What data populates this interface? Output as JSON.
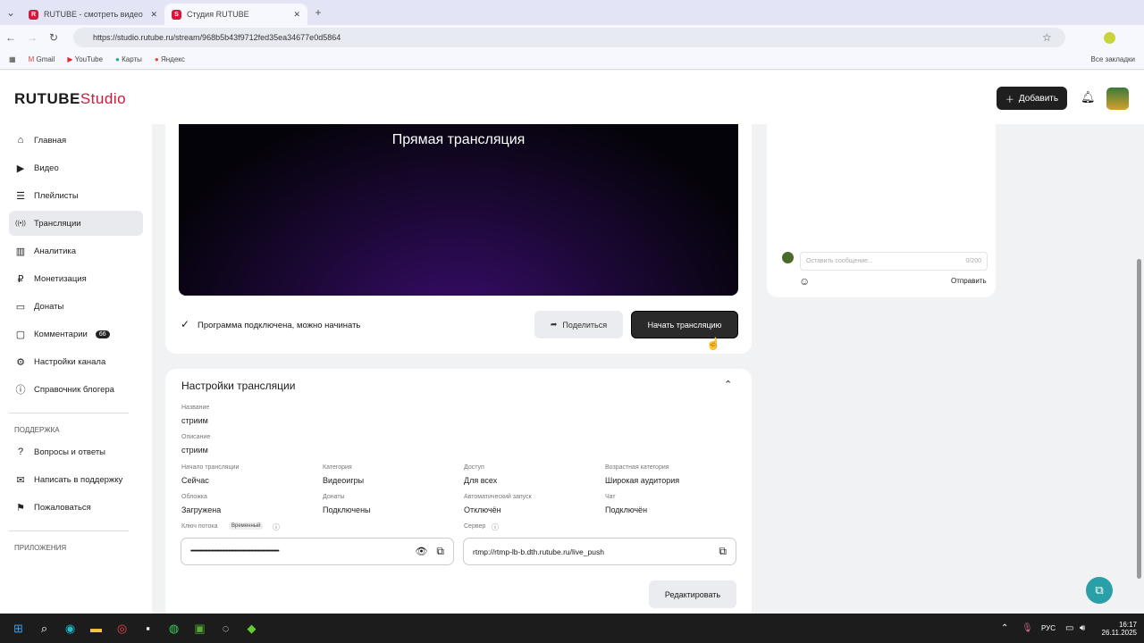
{
  "browser": {
    "tabs": [
      {
        "title": "RUTUBE - смотреть видео онлайн",
        "icon": "R"
      },
      {
        "title": "Студия RUTUBE",
        "icon": "S"
      }
    ],
    "url": "https://studio.rutube.ru/stream/968b5b43f9712fed35ea34677e0d5864",
    "bookmarks": [
      "Gmail",
      "YouTube",
      "Карты",
      "Яндекс"
    ],
    "all_bookmarks": "Все закладки"
  },
  "header": {
    "logo": "RUTUBE",
    "logo_suffix": "Studio",
    "add_label": "Добавить"
  },
  "sidebar": {
    "items": [
      {
        "label": "Главная",
        "icon": "⌂"
      },
      {
        "label": "Видео",
        "icon": "▶"
      },
      {
        "label": "Плейлисты",
        "icon": "☰"
      },
      {
        "label": "Трансляции",
        "icon": "((•))"
      },
      {
        "label": "Аналитика",
        "icon": "▥"
      },
      {
        "label": "Монетизация",
        "icon": "₽"
      },
      {
        "label": "Донаты",
        "icon": "▭"
      },
      {
        "label": "Комментарии",
        "icon": "▢",
        "badge": "66"
      },
      {
        "label": "Настройки канала",
        "icon": "⚙"
      },
      {
        "label": "Справочник блогера",
        "icon": "ⓘ"
      }
    ],
    "support_title": "ПОДДЕРЖКА",
    "support": [
      {
        "label": "Вопросы и ответы",
        "icon": "?"
      },
      {
        "label": "Написать в поддержку",
        "icon": "✉"
      },
      {
        "label": "Пожаловаться",
        "icon": "⚑"
      }
    ],
    "apps_title": "ПРИЛОЖЕНИЯ"
  },
  "player": {
    "title": "Прямая трансляция",
    "status": "Программа подключена, можно начинать",
    "share": "Поделиться",
    "start": "Начать трансляцию"
  },
  "chat": {
    "placeholder": "Оставить сообщение...",
    "counter": "0/200",
    "send": "Отправить"
  },
  "settings": {
    "title": "Настройки трансляции",
    "name_label": "Название",
    "name": "стриим",
    "desc_label": "Описание",
    "desc": "стриим",
    "fields": [
      {
        "label": "Начало трансляции",
        "value": "Сейчас"
      },
      {
        "label": "Категория",
        "value": "Видеоигры"
      },
      {
        "label": "Доступ",
        "value": "Для всех"
      },
      {
        "label": "Возрастная категория",
        "value": "Широкая аудитория"
      },
      {
        "label": "Обложка",
        "value": "Загружена"
      },
      {
        "label": "Донаты",
        "value": "Подключены"
      },
      {
        "label": "Автоматический запуск",
        "value": "Отключён"
      },
      {
        "label": "Чат",
        "value": "Подключён"
      }
    ],
    "key_label": "Ключ потока",
    "key_tag": "Временный",
    "key_value": "••••••••••••••••••••••••••••••••••••••••••••••••••••••••••••••••••••",
    "server_label": "Сервер",
    "server_value": "rtmp://rtmp-lb-b.dth.rutube.ru/live_push",
    "edit": "Редактировать"
  },
  "taskbar": {
    "lang": "РУС",
    "time": "16:17",
    "date": "26.11.2025"
  }
}
